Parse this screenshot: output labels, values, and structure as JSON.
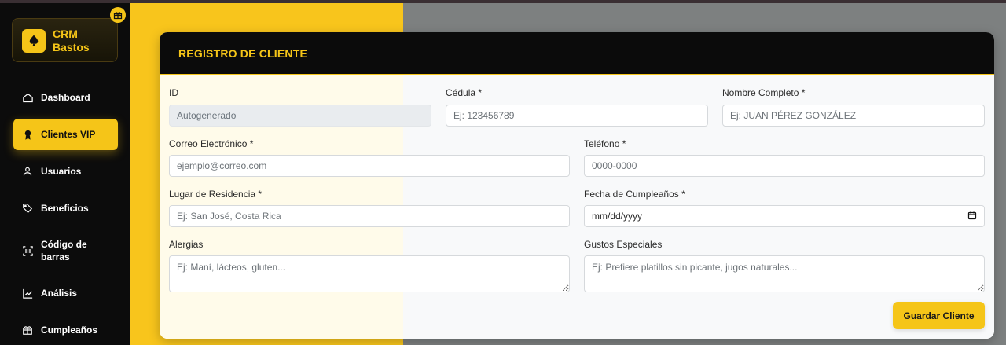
{
  "brand": {
    "line1": "CRM",
    "line2": "Bastos",
    "accent": "#f5c518",
    "logo_icon": "spade-icon",
    "badge_icon": "gift-icon"
  },
  "sidebar": {
    "items": [
      {
        "label": "Dashboard",
        "icon": "home-icon"
      },
      {
        "label": "Clientes VIP",
        "icon": "award-icon",
        "active": true
      },
      {
        "label": "Usuarios",
        "icon": "user-icon"
      },
      {
        "label": "Beneficios",
        "icon": "tag-icon"
      },
      {
        "label": "Código de barras",
        "icon": "barcode-scan-icon"
      },
      {
        "label": "Análisis",
        "icon": "chart-line-icon"
      },
      {
        "label": "Cumpleaños",
        "icon": "gift-icon"
      }
    ]
  },
  "form": {
    "title": "REGISTRO DE CLIENTE",
    "fields": {
      "id": {
        "label": "ID",
        "placeholder": "Autogenerado"
      },
      "cedula": {
        "label": "Cédula *",
        "placeholder": "Ej: 123456789"
      },
      "nombre": {
        "label": "Nombre Completo *",
        "placeholder": "Ej: JUAN PÉREZ GONZÁLEZ"
      },
      "correo": {
        "label": "Correo Electrónico *",
        "placeholder": "ejemplo@correo.com"
      },
      "telefono": {
        "label": "Teléfono *",
        "placeholder": "0000-0000"
      },
      "residencia": {
        "label": "Lugar de Residencia *",
        "placeholder": "Ej: San José, Costa Rica"
      },
      "cumple": {
        "label": "Fecha de Cumpleaños *",
        "value": "mm/dd/yyyy"
      },
      "alergias": {
        "label": "Alergias",
        "placeholder": "Ej: Maní, lácteos, gluten..."
      },
      "gustos": {
        "label": "Gustos Especiales",
        "placeholder": "Ej: Prefiere platillos sin picante, jugos naturales..."
      }
    },
    "save_label": "Guardar Cliente"
  }
}
